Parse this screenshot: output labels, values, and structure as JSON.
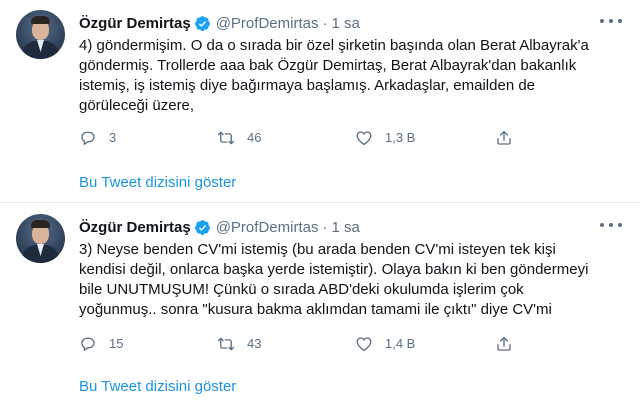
{
  "tweets": [
    {
      "author_name": "Özgür Demirtaş",
      "handle": "@ProfDemirtas",
      "separator": "·",
      "time": "1 sa",
      "text": "4) göndermişim. O da o sırada bir özel şirketin başında olan Berat Albayrak'a\ngöndermiş. Trollerde aaa bak Özgür Demirtaş, Berat Albayrak'dan bakanlık\nistemiş, iş istemiş diye bağırmaya başlamış. Arkadaşlar, emailden de\ngörüleceği üzere,",
      "replies": "3",
      "retweets": "46",
      "likes": "1,3 B",
      "thread_link": "Bu Tweet dizisini göster"
    },
    {
      "author_name": "Özgür Demirtaş",
      "handle": "@ProfDemirtas",
      "separator": "·",
      "time": "1 sa",
      "text": "3) Neyse benden CV'mi istemiş (bu arada benden CV'mi isteyen tek kişi\nkendisi değil, onlarca başka yerde istemiştir). Olaya bakın ki ben göndermeyi\nbile UNUTMUŞUM! Çünkü o sırada ABD'deki okulumda işlerim çok\nyoğunmuş.. sonra \"kusura bakma aklımdan tamami ile çıktı\" diye CV'mi",
      "replies": "15",
      "retweets": "43",
      "likes": "1,4 B",
      "thread_link": "Bu Tweet dizisini göster"
    }
  ],
  "colors": {
    "accent": "#1b95e0",
    "verified": "#1da1f2",
    "secondary_text": "#5b7083",
    "divider": "#e6ecf0"
  },
  "icons": [
    "verified-badge-icon",
    "more-options-icon",
    "reply-icon",
    "retweet-icon",
    "like-icon",
    "share-icon"
  ]
}
